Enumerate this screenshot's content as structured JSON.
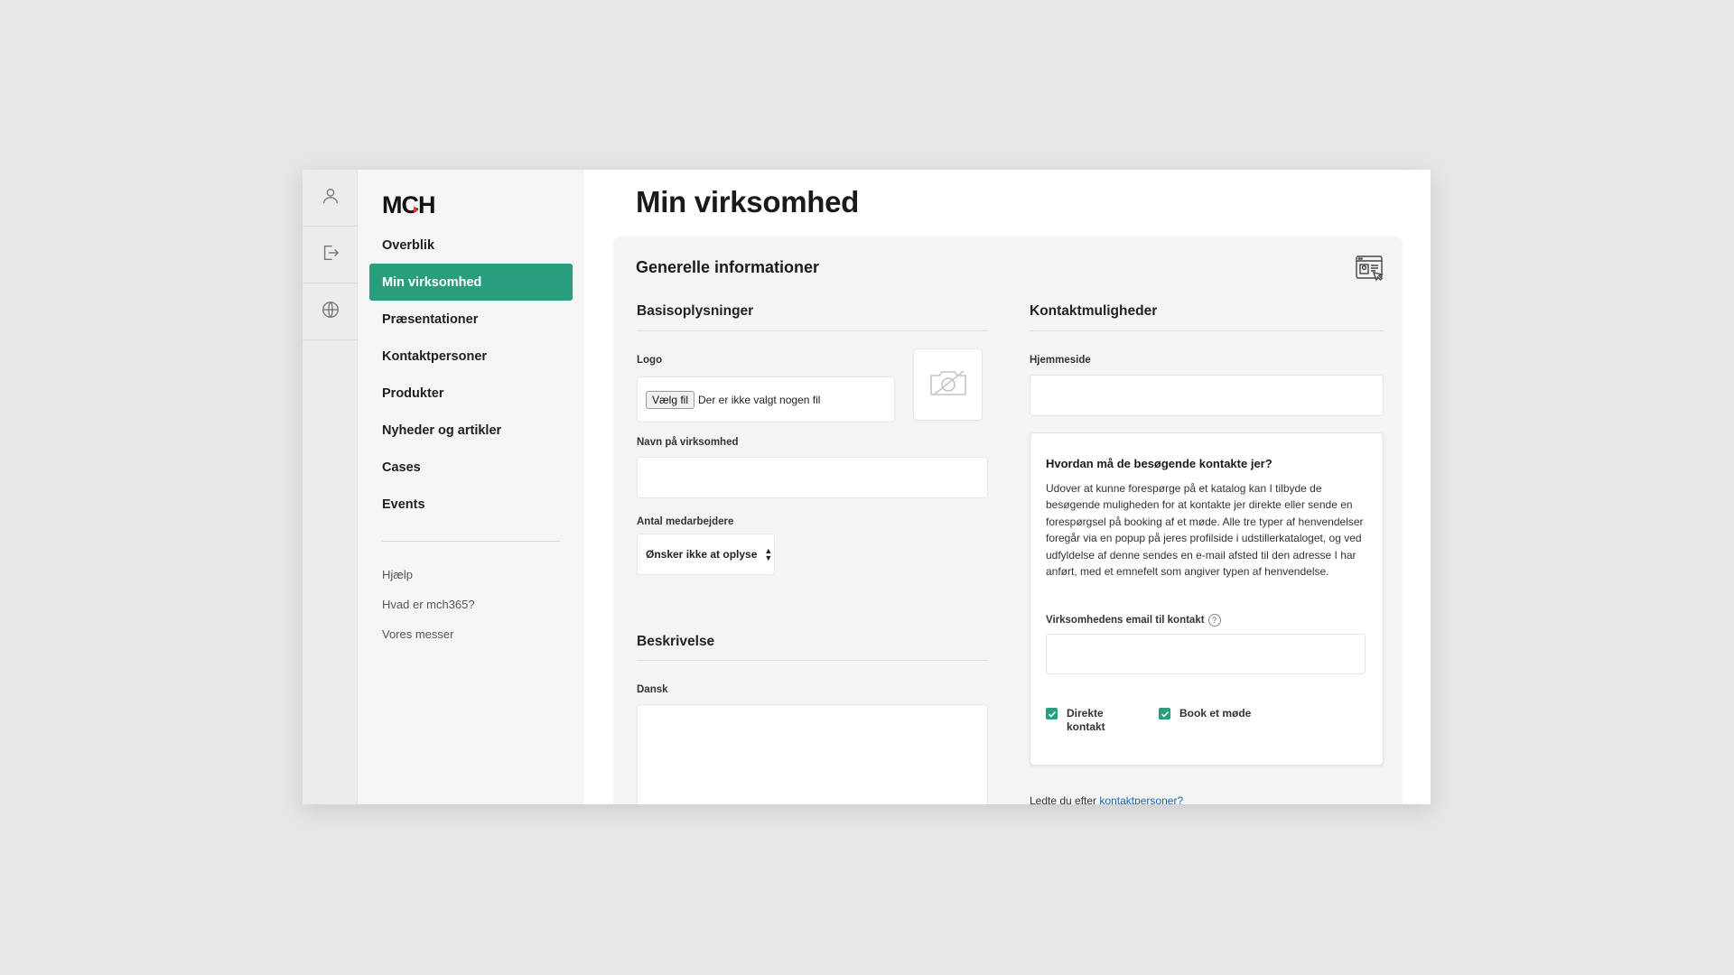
{
  "rail": {
    "icons": [
      "user-icon",
      "logout-icon",
      "globe-icon"
    ]
  },
  "sidebar": {
    "logo_text": "MCH",
    "nav": [
      {
        "label": "Overblik",
        "active": false
      },
      {
        "label": "Min virksomhed",
        "active": true
      },
      {
        "label": "Præsentationer",
        "active": false
      },
      {
        "label": "Kontaktpersoner",
        "active": false
      },
      {
        "label": "Produkter",
        "active": false
      },
      {
        "label": "Nyheder og artikler",
        "active": false
      },
      {
        "label": "Cases",
        "active": false
      },
      {
        "label": "Events",
        "active": false
      }
    ],
    "links": [
      "Hjælp",
      "Hvad er mch365?",
      "Vores messer"
    ]
  },
  "main": {
    "page_title": "Min virksomhed",
    "card_title": "Generelle informationer",
    "basis": {
      "title": "Basisoplysninger",
      "logo_label": "Logo",
      "file_button": "Vælg fil",
      "file_status": "Der er ikke valgt nogen fil",
      "company_name_label": "Navn på virksomhed",
      "company_name_value": "",
      "employees_label": "Antal medarbejdere",
      "employees_value": "Ønsker ikke at oplyse"
    },
    "description": {
      "title": "Beskrivelse",
      "danish_label": "Dansk",
      "danish_value": ""
    },
    "contact": {
      "title": "Kontaktmuligheder",
      "website_label": "Hjemmeside",
      "website_value": "",
      "info_title": "Hvordan må de besøgende kontakte jer?",
      "info_text": "Udover at kunne forespørge på et katalog kan I tilbyde de besøgende muligheden for at kontakte jer direkte eller sende en forespørgsel på booking af et møde. Alle tre typer af henvendelser foregår via en popup på jeres profilside i udstillerkataloget, og ved udfyldelse af denne sendes en e-mail afsted til den adresse I har anført, med et emnefelt som angiver typen af henvendelse.",
      "email_label": "Virksomhedens email til kontakt",
      "email_value": "",
      "checkbox_direct_line1": "Direkte",
      "checkbox_direct_line2": "kontakt",
      "checkbox_direct_checked": true,
      "checkbox_meeting": "Book et møde",
      "checkbox_meeting_checked": true,
      "footer_prefix": "Ledte du efter ",
      "footer_link": "kontaktpersoner?"
    }
  },
  "colors": {
    "accent": "#2a9d7f",
    "link": "#1a5fb4"
  }
}
